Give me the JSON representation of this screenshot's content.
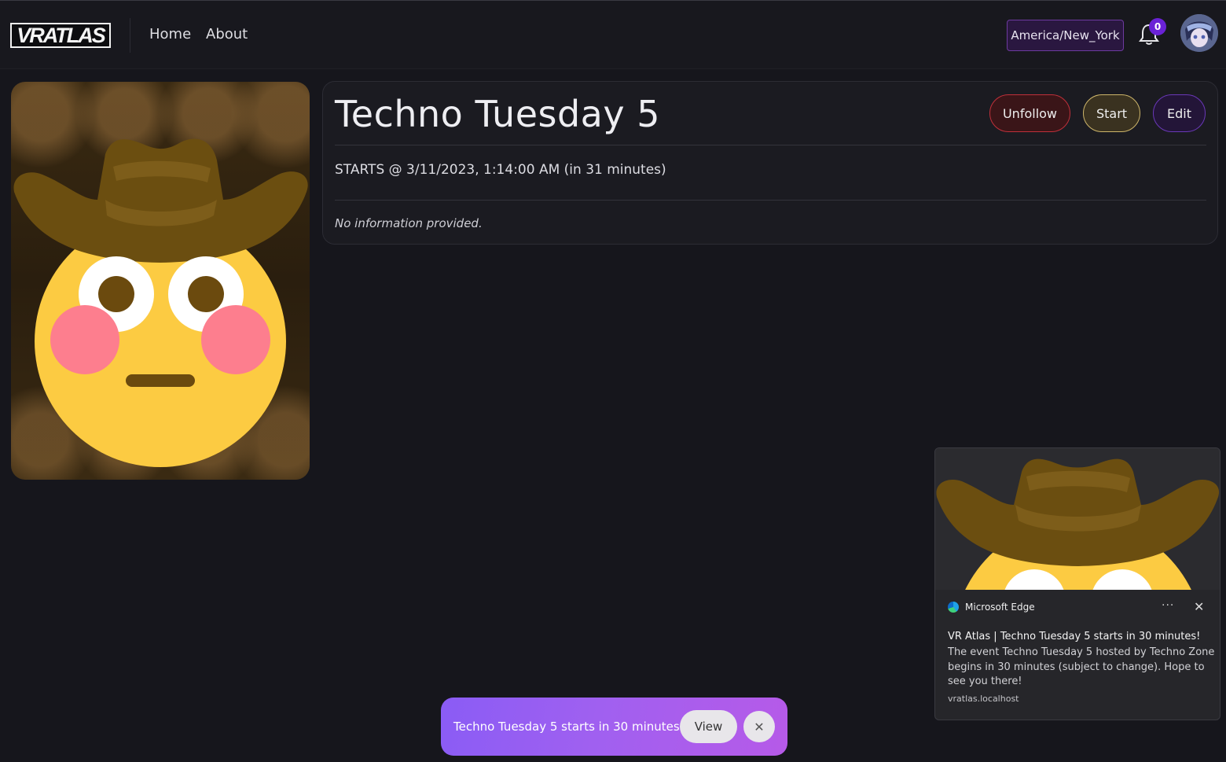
{
  "navbar": {
    "logo_text": "VRATLAS",
    "links": [
      {
        "label": "Home"
      },
      {
        "label": "About"
      }
    ],
    "timezone_label": "America/New_York",
    "notification_count": "0"
  },
  "event": {
    "title": "Techno Tuesday 5",
    "actions": {
      "unfollow_label": "Unfollow",
      "start_label": "Start",
      "edit_label": "Edit"
    },
    "starts_text": "STARTS @ 3/11/2023, 1:14:00 AM (in 31 minutes)",
    "description": "No information provided."
  },
  "os_notification": {
    "app_name": "Microsoft Edge",
    "more_label": "···",
    "close_label": "✕",
    "title": "VR Atlas | Techno Tuesday 5 starts in 30 minutes!",
    "body": "The event Techno Tuesday 5 hosted by Techno Zone begins in 30 minutes (subject to change). Hope to see you there!",
    "source": "vratlas.localhost"
  },
  "toast": {
    "message": "Techno Tuesday 5 starts in 30 minutes!",
    "view_label": "View",
    "close_label": "✕"
  },
  "colors": {
    "background": "#16161c",
    "accent_purple": "#6a22d6",
    "unfollow_border": "#c0303a",
    "start_border": "#cdb56a",
    "edit_border": "#6a38b8"
  }
}
